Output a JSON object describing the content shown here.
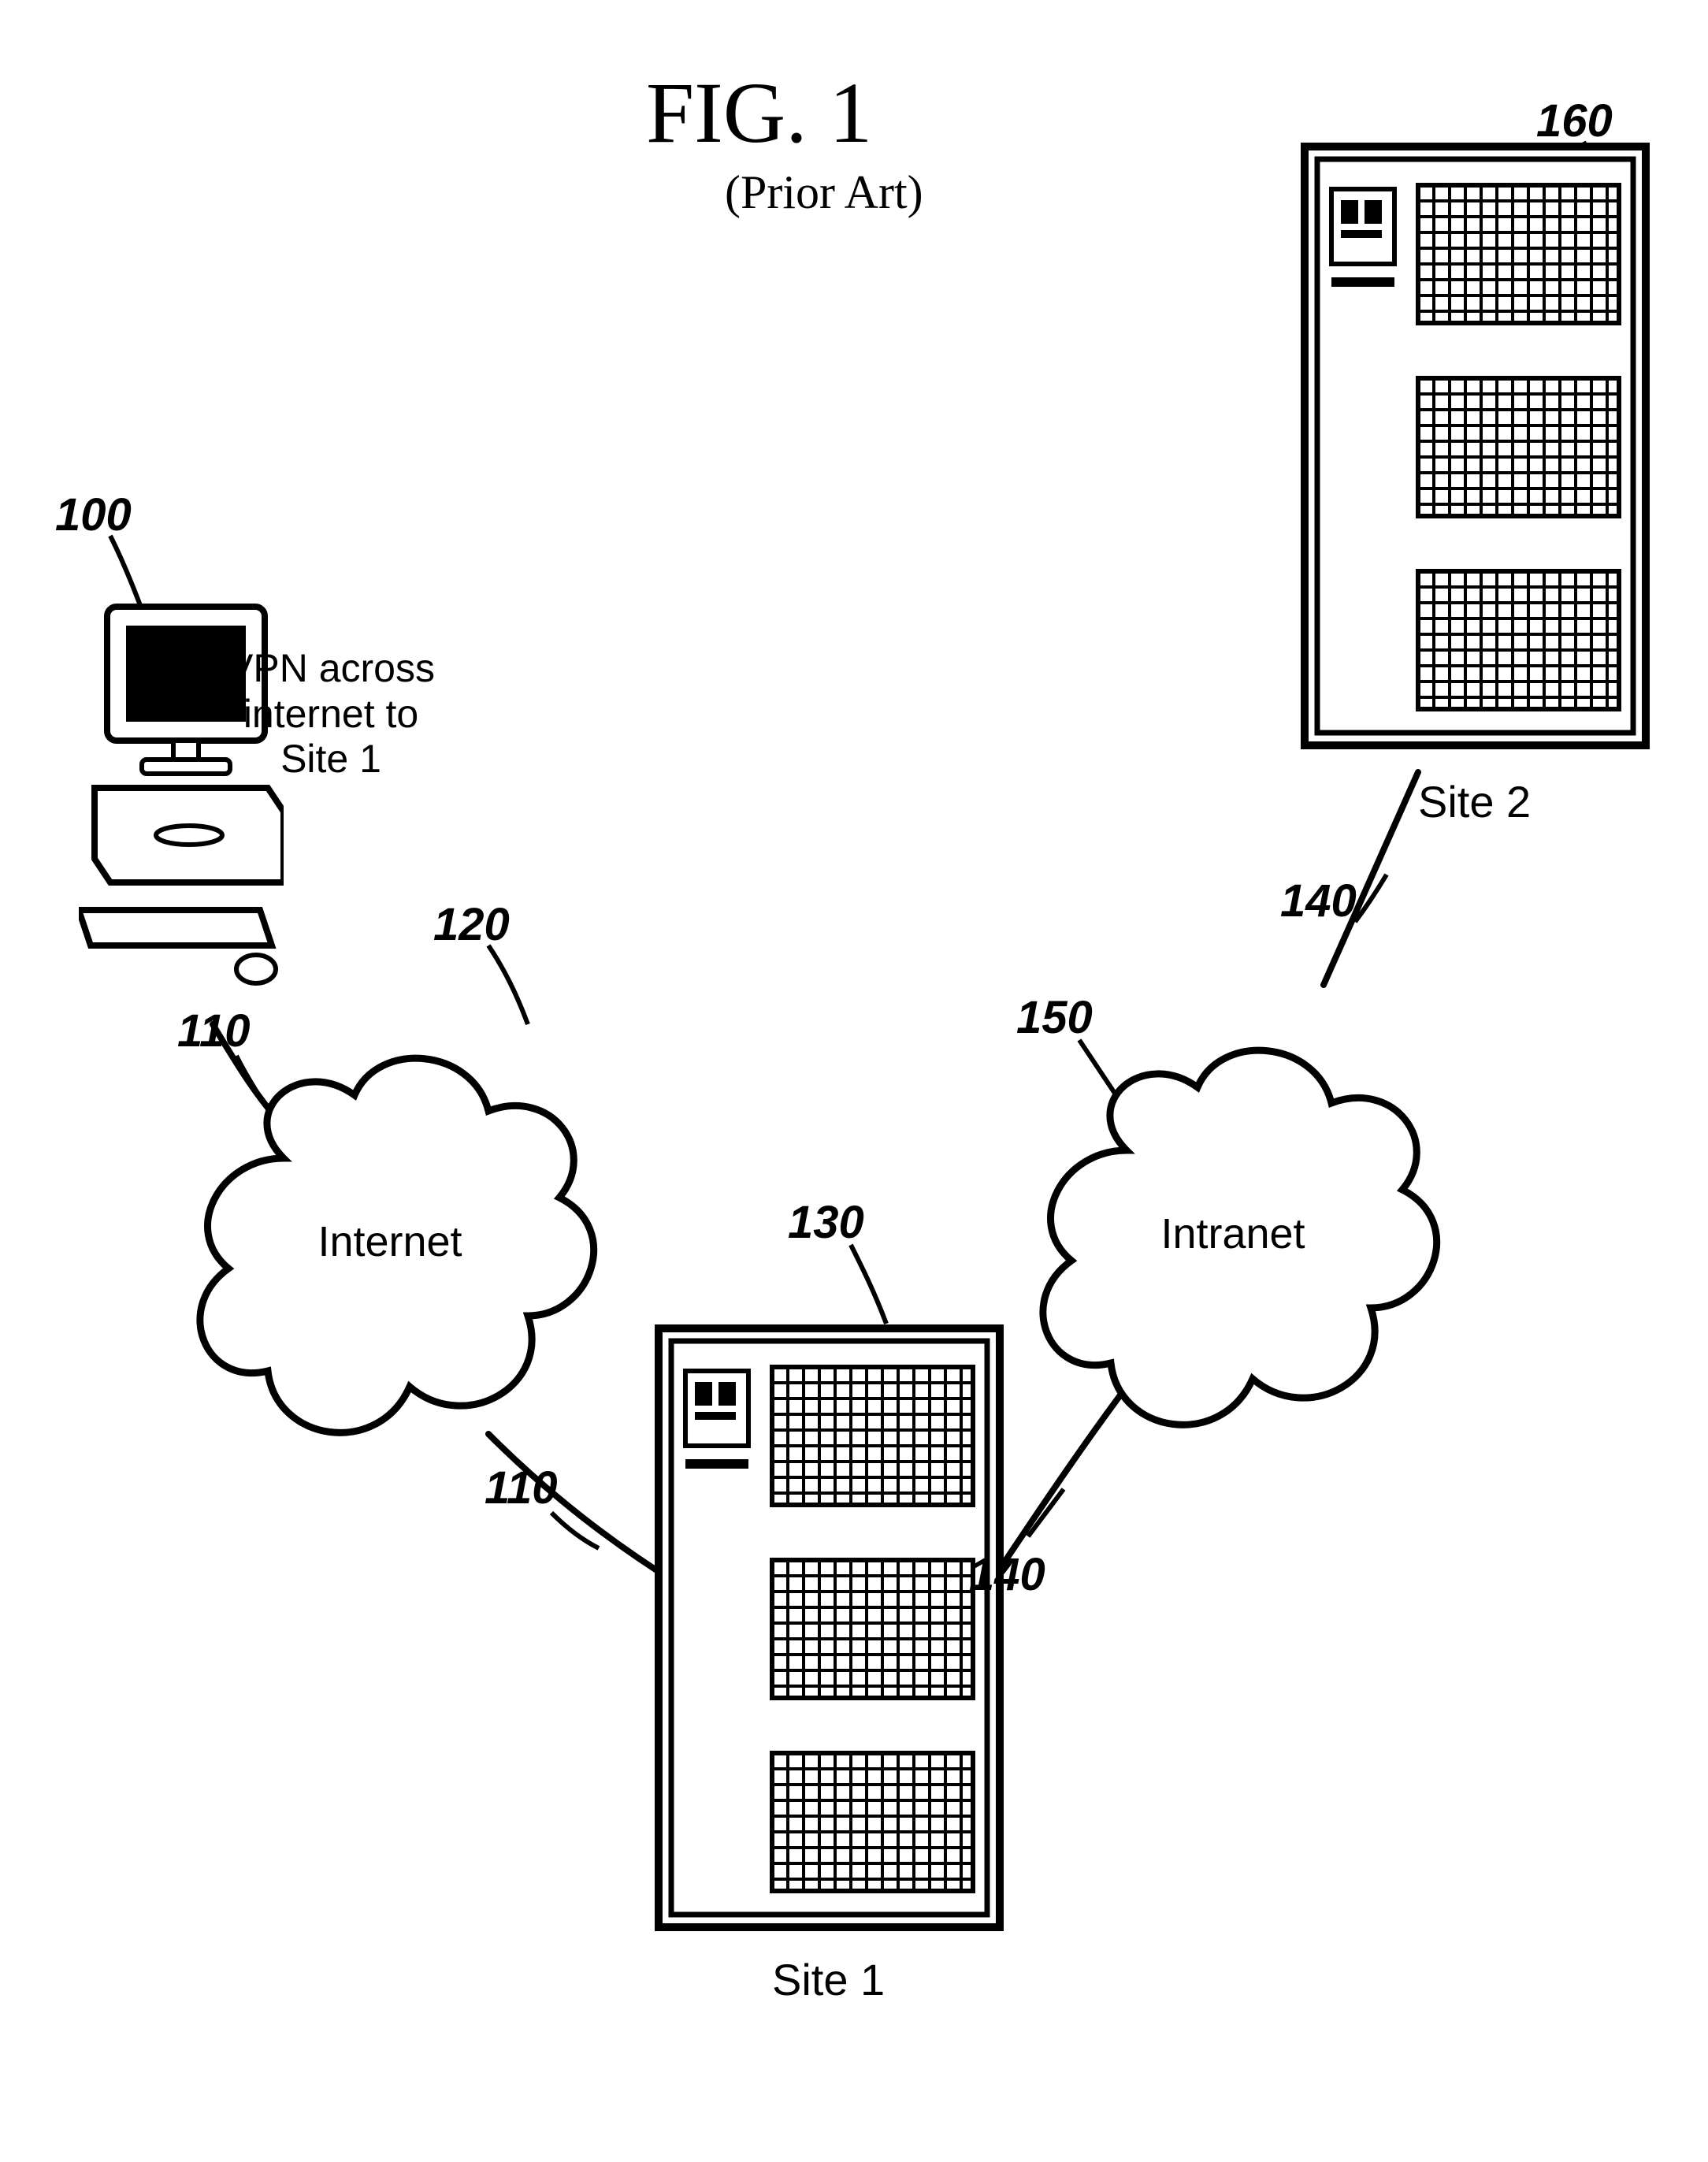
{
  "title": {
    "line1": "FIG. 1",
    "line2": "(Prior Art)"
  },
  "vpn_caption": {
    "l1": "VPN across",
    "l2": "internet to",
    "l3": "Site 1"
  },
  "cloud_internet": "Internet",
  "cloud_intranet": "Intranet",
  "site1": "Site 1",
  "site2": "Site 2",
  "ref": {
    "r100": "100",
    "r110a": "110",
    "r110b": "110",
    "r120": "120",
    "r130": "130",
    "r140a": "140",
    "r140b": "140",
    "r150": "150",
    "r160": "160"
  }
}
